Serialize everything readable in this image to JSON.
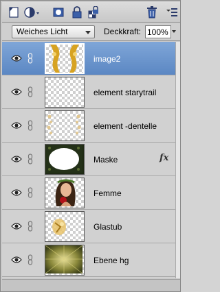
{
  "toolbar": {
    "icons": [
      "new-layer-icon",
      "adjustment-layer-icon",
      "layer-mask-icon",
      "lock-icon",
      "lock-transparency-icon",
      "trash-icon",
      "panel-menu-icon"
    ]
  },
  "options": {
    "blend_mode": "Weiches Licht",
    "opacity_label": "Deckkraft:",
    "opacity_value": "100%"
  },
  "layers": [
    {
      "name": "image2",
      "selected": true,
      "fx": "",
      "thumb": "gold-ornament"
    },
    {
      "name": "element starytrail",
      "selected": false,
      "fx": "",
      "thumb": "transparent"
    },
    {
      "name": "element -dentelle",
      "selected": false,
      "fx": "",
      "thumb": "dentelle"
    },
    {
      "name": "Maske",
      "selected": false,
      "fx": "fx",
      "thumb": "mask"
    },
    {
      "name": "Femme",
      "selected": false,
      "fx": "",
      "thumb": "femme"
    },
    {
      "name": "Glastub",
      "selected": false,
      "fx": "",
      "thumb": "glastub"
    },
    {
      "name": "Ebene hg",
      "selected": false,
      "fx": "",
      "thumb": "background"
    }
  ],
  "colors": {
    "selected_row": "#6b95cc",
    "panel_bg": "#d1d1d1"
  }
}
